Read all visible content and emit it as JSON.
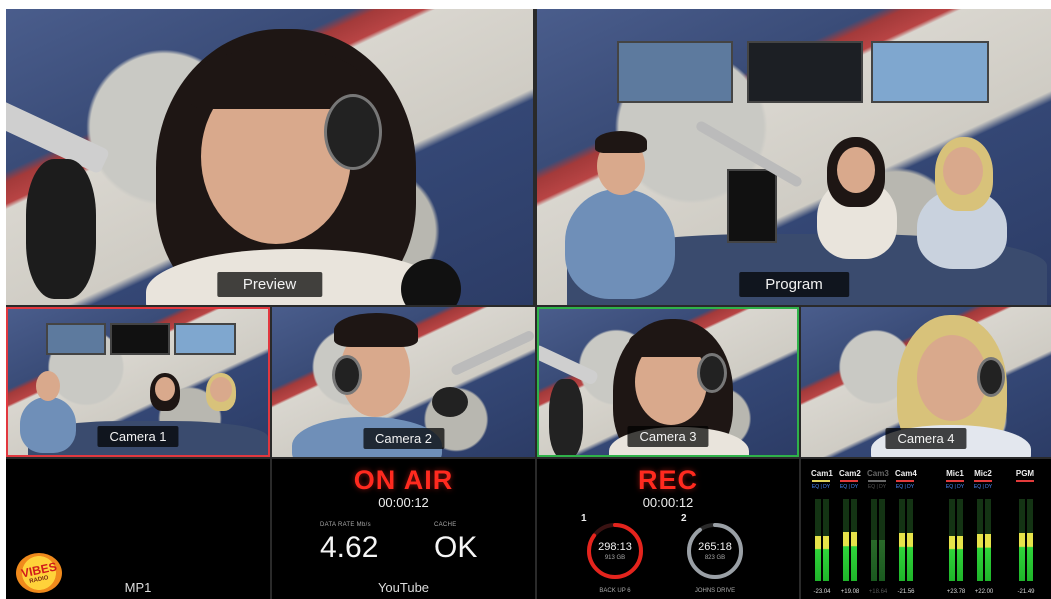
{
  "multiview": {
    "preview_label": "Preview",
    "program_label": "Program",
    "cameras": [
      {
        "label": "Camera 1",
        "tally": "red"
      },
      {
        "label": "Camera 2",
        "tally": "none"
      },
      {
        "label": "Camera 3",
        "tally": "green"
      },
      {
        "label": "Camera 4",
        "tally": "none"
      }
    ]
  },
  "media_player": {
    "label": "MP1",
    "logo_text": "VIBES",
    "logo_sub": "RADIO"
  },
  "stream": {
    "status": "ON AIR",
    "timecode": "00:00:12",
    "data_rate_caption": "DATA RATE Mb/s",
    "data_rate": "4.62",
    "cache_caption": "CACHE",
    "cache": "OK",
    "platform": "YouTube"
  },
  "record": {
    "status": "REC",
    "timecode": "00:00:12",
    "drives": [
      {
        "index": "1",
        "time": "298:13",
        "size": "913 GB",
        "name": "BACK UP 6",
        "ring_color": "#e4241d",
        "fill_fraction": 0.85
      },
      {
        "index": "2",
        "time": "265:18",
        "size": "823 GB",
        "name": "JOHNS DRIVE",
        "ring_color": "#9aa0a6",
        "fill_fraction": 0.9
      }
    ]
  },
  "audio": {
    "channels": [
      {
        "name": "Cam1",
        "tag": "EQ | DY",
        "line": "#e0d35a",
        "value": "-23.04",
        "level": 0.55,
        "active": true
      },
      {
        "name": "Cam2",
        "tag": "EQ | DY",
        "line": "#e23b3b",
        "value": "+19.08",
        "level": 0.6,
        "active": true
      },
      {
        "name": "Cam3",
        "tag": "EQ | DY",
        "line": "#6a6a6a",
        "value": "+18.64",
        "level": 0.5,
        "active": false
      },
      {
        "name": "Cam4",
        "tag": "EQ | DY",
        "line": "#e23b3b",
        "value": "-21.56",
        "level": 0.58,
        "active": true
      },
      {
        "name": "Mic1",
        "tag": "EQ | DY",
        "line": "#e23b3b",
        "value": "+23.78",
        "level": 0.55,
        "active": true
      },
      {
        "name": "Mic2",
        "tag": "EQ | DY",
        "line": "#e23b3b",
        "value": "+22.00",
        "level": 0.57,
        "active": true
      },
      {
        "name": "PGM",
        "tag": "",
        "line": "#e23b3b",
        "value": "-21.49",
        "level": 0.58,
        "active": true
      }
    ]
  }
}
